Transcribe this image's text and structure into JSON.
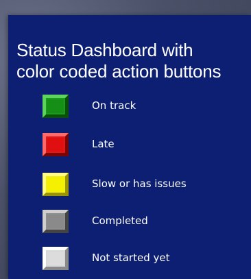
{
  "title": {
    "line1": "Status Dashboard with",
    "line2": "color coded action buttons"
  },
  "legend": [
    {
      "label": "On track",
      "color": "#1fa81f",
      "status": "on-track"
    },
    {
      "label": "Late",
      "color": "#e01818",
      "status": "late"
    },
    {
      "label": "Slow or has issues",
      "color": "#f2ee12",
      "status": "slow"
    },
    {
      "label": "Completed",
      "color": "#8f8f8f",
      "status": "completed"
    },
    {
      "label": "Not started yet",
      "color": "#d8d8d8",
      "status": "not-started"
    }
  ]
}
